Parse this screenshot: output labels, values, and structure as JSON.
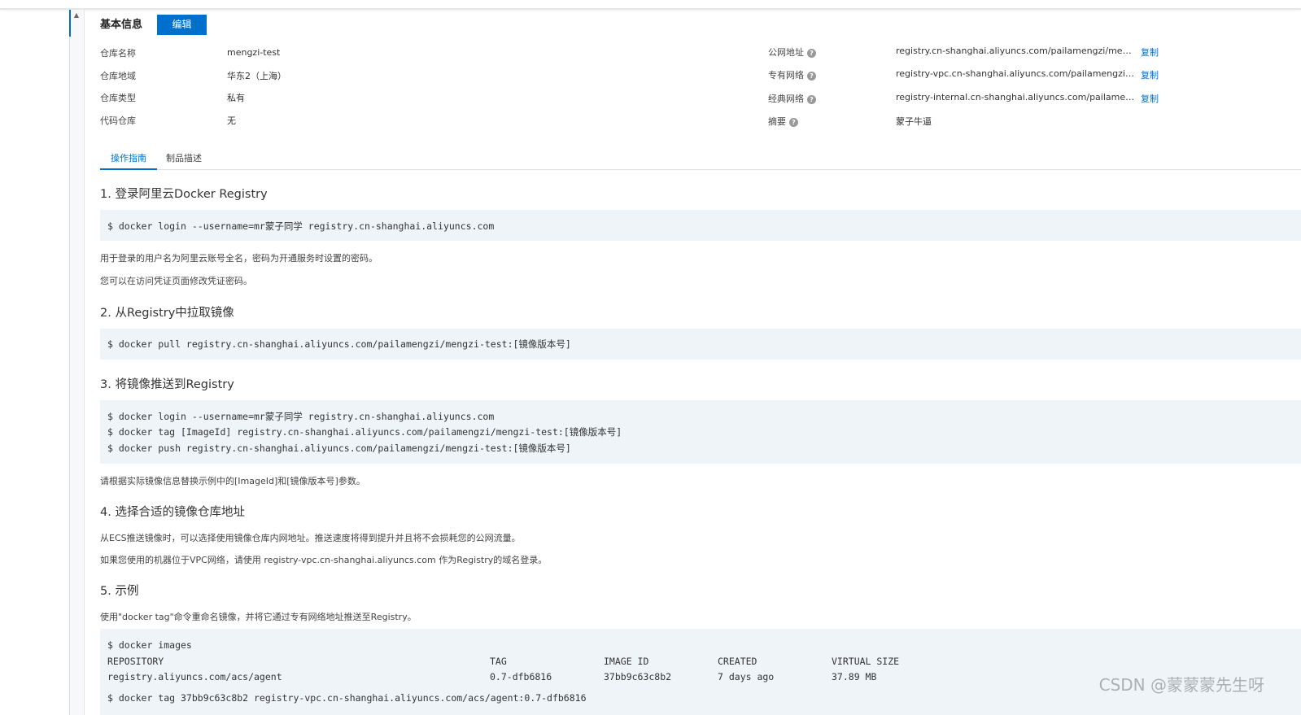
{
  "colors": {
    "accent": "#0070cc",
    "code_background": "#eef4f8",
    "gutter_background": "#f7f8fa"
  },
  "basic_info": {
    "title": "基本信息",
    "edit_label": "编辑",
    "rows": [
      {
        "label": "仓库名称",
        "value": "mengzi-test"
      },
      {
        "label": "仓库地域",
        "value": "华东2（上海）"
      },
      {
        "label": "仓库类型",
        "value": "私有"
      },
      {
        "label": "代码仓库",
        "value": "无"
      }
    ],
    "address_rows": [
      {
        "label": "公网地址",
        "value": "registry.cn-shanghai.aliyuncs.com/pailamengzi/mengzi-test",
        "copy": "复制"
      },
      {
        "label": "专有网络",
        "value": "registry-vpc.cn-shanghai.aliyuncs.com/pailamengzi/mengzi-test",
        "copy": "复制"
      },
      {
        "label": "经典网络",
        "value": "registry-internal.cn-shanghai.aliyuncs.com/pailamengzi/mengzi-test",
        "copy": "复制"
      }
    ],
    "summary": {
      "label": "摘要",
      "value": "蒙子牛逼"
    }
  },
  "tabs": {
    "guide": "操作指南",
    "description": "制品描述"
  },
  "guide": {
    "step1": {
      "heading": "1. 登录阿里云Docker Registry",
      "code": [
        "$ docker login --username=mr蒙子同学 registry.cn-shanghai.aliyuncs.com"
      ],
      "notes": [
        "用于登录的用户名为阿里云账号全名，密码为开通服务时设置的密码。",
        "您可以在访问凭证页面修改凭证密码。"
      ]
    },
    "step2": {
      "heading": "2. 从Registry中拉取镜像",
      "code": [
        "$ docker pull registry.cn-shanghai.aliyuncs.com/pailamengzi/mengzi-test:[镜像版本号]"
      ]
    },
    "step3": {
      "heading": "3. 将镜像推送到Registry",
      "code": [
        "$ docker login --username=mr蒙子同学 registry.cn-shanghai.aliyuncs.com",
        "$ docker tag [ImageId] registry.cn-shanghai.aliyuncs.com/pailamengzi/mengzi-test:[镜像版本号]",
        "$ docker push registry.cn-shanghai.aliyuncs.com/pailamengzi/mengzi-test:[镜像版本号]"
      ],
      "note": "请根据实际镜像信息替换示例中的[ImageId]和[镜像版本号]参数。"
    },
    "step4": {
      "heading": "4. 选择合适的镜像仓库地址",
      "notes": [
        "从ECS推送镜像时，可以选择使用镜像仓库内网地址。推送速度将得到提升并且将不会损耗您的公网流量。",
        "如果您使用的机器位于VPC网络，请使用 registry-vpc.cn-shanghai.aliyuncs.com 作为Registry的域名登录。"
      ]
    },
    "step5": {
      "heading": "5. 示例",
      "note": "使用\"docker tag\"命令重命名镜像，并将它通过专有网络地址推送至Registry。",
      "command": "$ docker images",
      "table_headers": [
        "REPOSITORY",
        "TAG",
        "IMAGE ID",
        "CREATED",
        "VIRTUAL SIZE"
      ],
      "table_row": [
        "registry.aliyuncs.com/acs/agent",
        "0.7-dfb6816",
        "37bb9c63c8b2",
        "7 days ago",
        "37.89 MB"
      ],
      "next_command": "$ docker tag 37bb9c63c8b2 registry-vpc.cn-shanghai.aliyuncs.com/acs/agent:0.7-dfb6816"
    }
  },
  "watermark": "CSDN @蒙蒙蒙先生呀"
}
